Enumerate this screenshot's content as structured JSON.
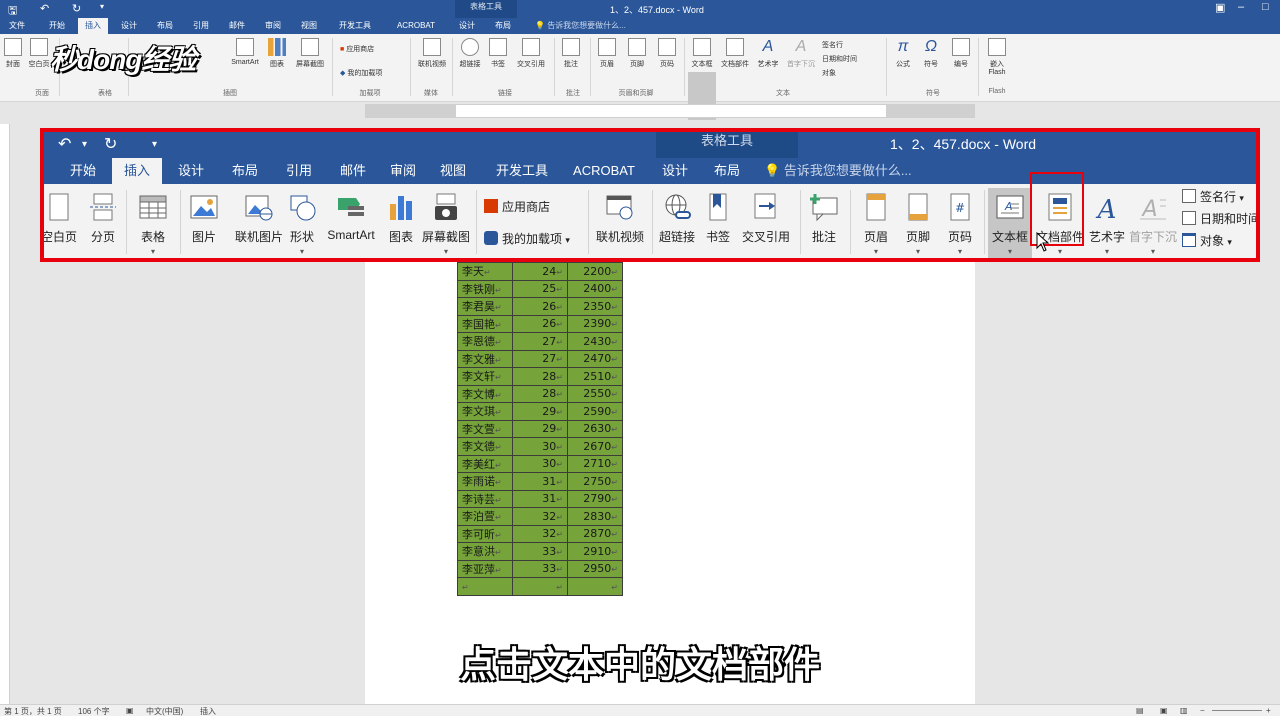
{
  "titlebar": {
    "context_tab": "表格工具",
    "doc_title": "1、2、457.docx - Word"
  },
  "tabs": [
    {
      "label": "文件"
    },
    {
      "label": "开始"
    },
    {
      "label": "插入"
    },
    {
      "label": "设计"
    },
    {
      "label": "布局"
    },
    {
      "label": "引用"
    },
    {
      "label": "邮件"
    },
    {
      "label": "审阅"
    },
    {
      "label": "视图"
    },
    {
      "label": "开发工具"
    },
    {
      "label": "ACROBAT"
    },
    {
      "label": "设计"
    },
    {
      "label": "布局"
    }
  ],
  "tell_me": "告诉我您想要做什么...",
  "ribbon": {
    "buttons": [
      "封面",
      "空白页",
      "表格",
      "SmartArt",
      "图表",
      "屏幕截图",
      "应用商店",
      "我的加载项",
      "联机视频",
      "超链接",
      "书签",
      "交叉引用",
      "批注",
      "页眉",
      "页脚",
      "页码",
      "文本框",
      "文档部件",
      "艺术字",
      "首字下沉",
      "签名行",
      "日期和时间",
      "对象",
      "公式",
      "符号",
      "编号",
      "嵌入Flash"
    ],
    "groups": [
      "页面",
      "表格",
      "插图",
      "加载项",
      "媒体",
      "链接",
      "批注",
      "页眉和页脚",
      "文本",
      "符号",
      "Flash"
    ]
  },
  "watermark": "秒dong经验",
  "zoom": {
    "context_tab": "表格工具",
    "doc_title": "1、2、457.docx - Word",
    "tabs": [
      {
        "label": "开始"
      },
      {
        "label": "插入"
      },
      {
        "label": "设计"
      },
      {
        "label": "布局"
      },
      {
        "label": "引用"
      },
      {
        "label": "邮件"
      },
      {
        "label": "审阅"
      },
      {
        "label": "视图"
      },
      {
        "label": "开发工具"
      },
      {
        "label": "ACROBAT"
      },
      {
        "label": "设计"
      },
      {
        "label": "布局"
      }
    ],
    "tell_me": "告诉我您想要做什么...",
    "buttons": {
      "blank_page": "空白页",
      "page_break": "分页",
      "table": "表格",
      "picture": "图片",
      "online_picture": "联机图片",
      "shapes": "形状",
      "smartart": "SmartArt",
      "chart": "图表",
      "screenshot": "屏幕截图",
      "store": "应用商店",
      "my_addins": "我的加载项",
      "online_video": "联机视频",
      "hyperlink": "超链接",
      "bookmark": "书签",
      "cross_ref": "交叉引用",
      "comment": "批注",
      "header": "页眉",
      "footer": "页脚",
      "page_number": "页码",
      "textbox": "文本框",
      "quick_parts": "文档部件",
      "wordart": "艺术字",
      "drop_cap": "首字下沉",
      "signature": "签名行",
      "datetime": "日期和时间",
      "object": "对象"
    }
  },
  "table": {
    "rows": [
      [
        "李天",
        "24",
        "2200"
      ],
      [
        "李铁刚",
        "25",
        "2400"
      ],
      [
        "李君昊",
        "26",
        "2350"
      ],
      [
        "李国艳",
        "26",
        "2390"
      ],
      [
        "李恩德",
        "27",
        "2430"
      ],
      [
        "李文雅",
        "27",
        "2470"
      ],
      [
        "李文轩",
        "28",
        "2510"
      ],
      [
        "李文博",
        "28",
        "2550"
      ],
      [
        "李文琪",
        "29",
        "2590"
      ],
      [
        "李文萱",
        "29",
        "2630"
      ],
      [
        "李文德",
        "30",
        "2670"
      ],
      [
        "李美红",
        "30",
        "2710"
      ],
      [
        "李雨诺",
        "31",
        "2750"
      ],
      [
        "李诗芸",
        "31",
        "2790"
      ],
      [
        "李泊萱",
        "32",
        "2830"
      ],
      [
        "李可昕",
        "32",
        "2870"
      ],
      [
        "李意洪",
        "33",
        "2910"
      ],
      [
        "李亚萍",
        "33",
        "2950"
      ],
      [
        "",
        "",
        ""
      ]
    ],
    "cell_mark": "↵"
  },
  "caption": "点击文本中的文档部件",
  "status": {
    "page": "第 1 页，共 1 页",
    "words": "106 个字",
    "lang": "中文(中国)",
    "mode": "插入"
  }
}
